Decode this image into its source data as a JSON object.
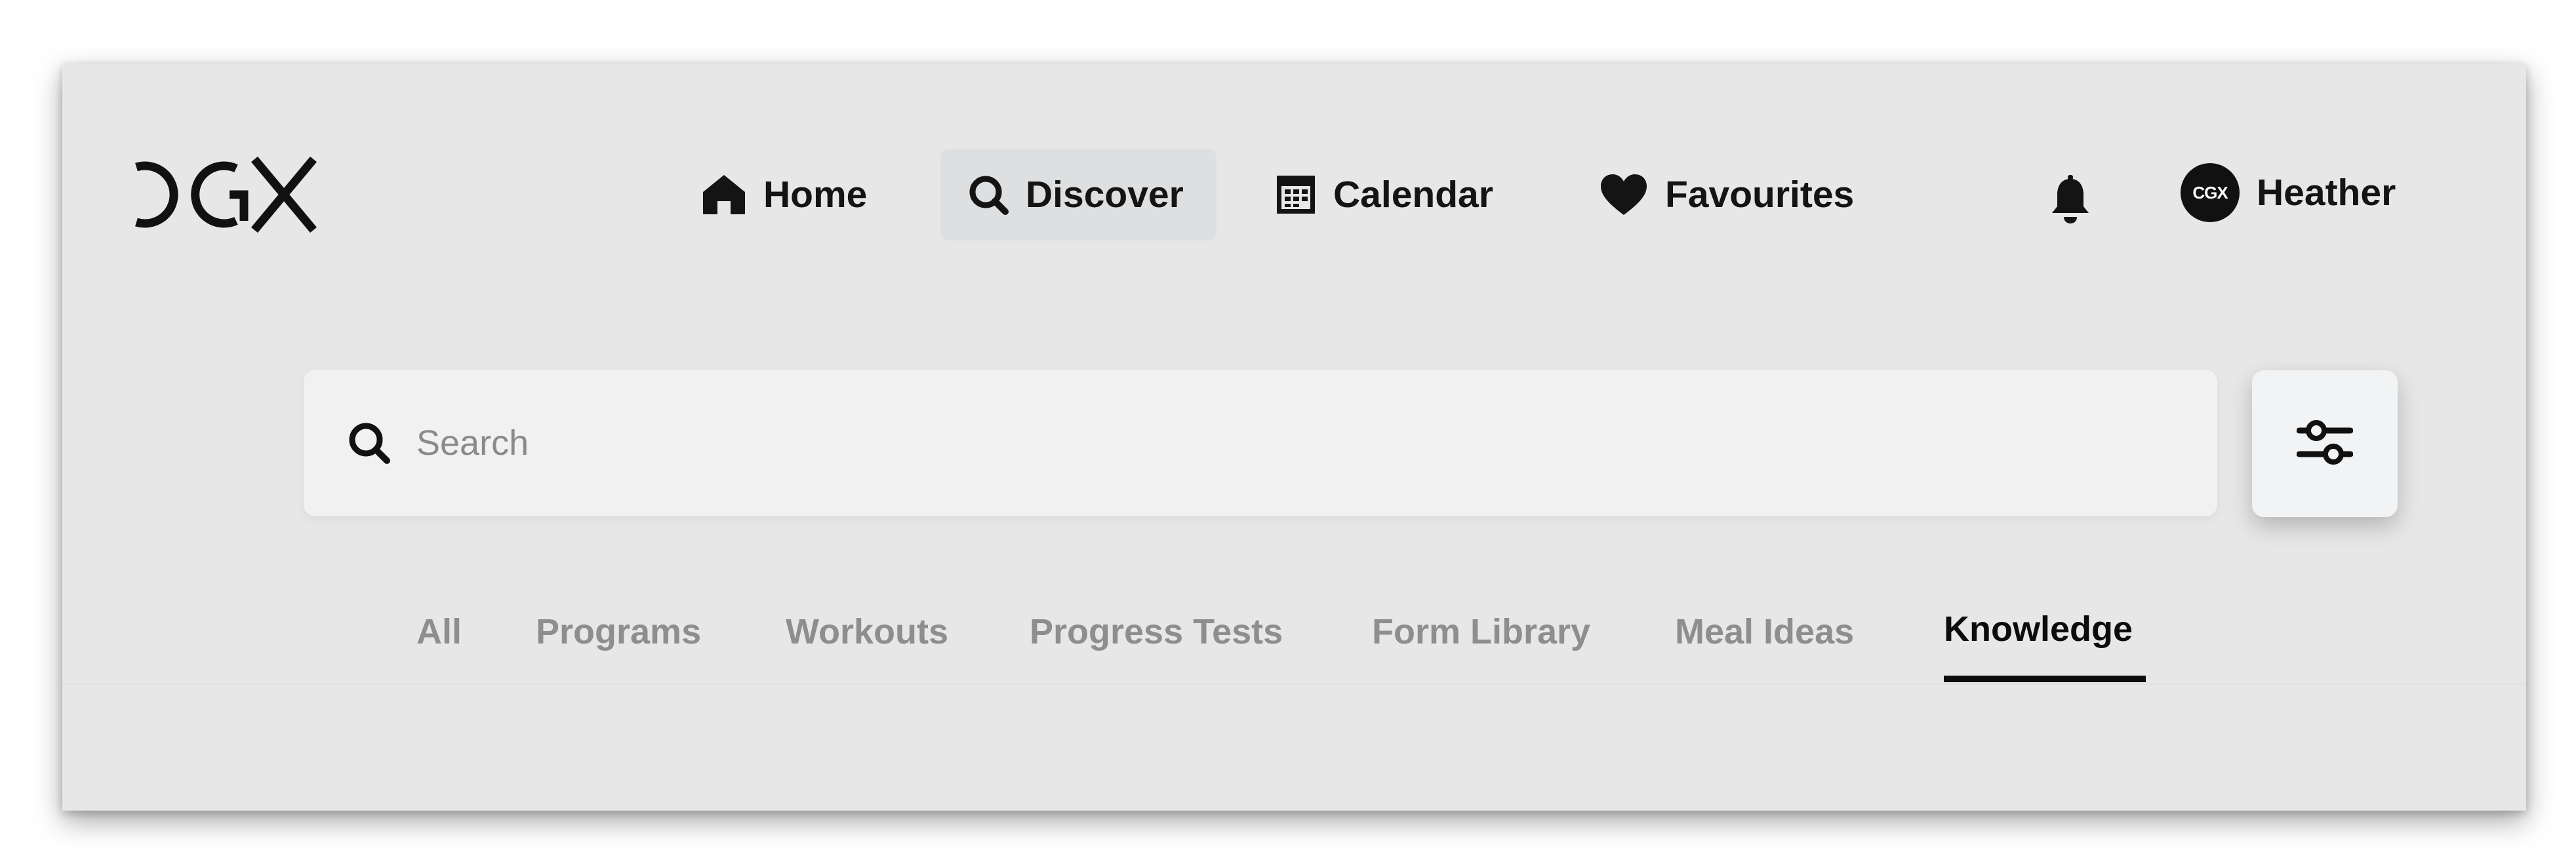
{
  "brand": {
    "logo_text": "CGX"
  },
  "nav": {
    "items": [
      {
        "label": "Home",
        "icon": "home-icon"
      },
      {
        "label": "Discover",
        "icon": "search-icon",
        "active": true
      },
      {
        "label": "Calendar",
        "icon": "calendar-icon"
      },
      {
        "label": "Favourites",
        "icon": "heart-icon"
      }
    ],
    "notifications_icon": "bell-icon",
    "profile": {
      "name": "Heather",
      "avatar_text": "CGX"
    }
  },
  "search": {
    "placeholder": "Search",
    "value": "",
    "filter_icon": "sliders-icon"
  },
  "tabs": {
    "items": [
      {
        "label": "All"
      },
      {
        "label": "Programs"
      },
      {
        "label": "Workouts"
      },
      {
        "label": "Progress Tests"
      },
      {
        "label": "Form Library"
      },
      {
        "label": "Meal Ideas"
      },
      {
        "label": "Knowledge",
        "active": true
      }
    ]
  },
  "colors": {
    "background": "#e7e7e7",
    "text": "#141414",
    "inactive_tab": "#8e8e8e",
    "active_nav_bg": "#dedfe1",
    "search_bg": "#f1f1f1"
  }
}
